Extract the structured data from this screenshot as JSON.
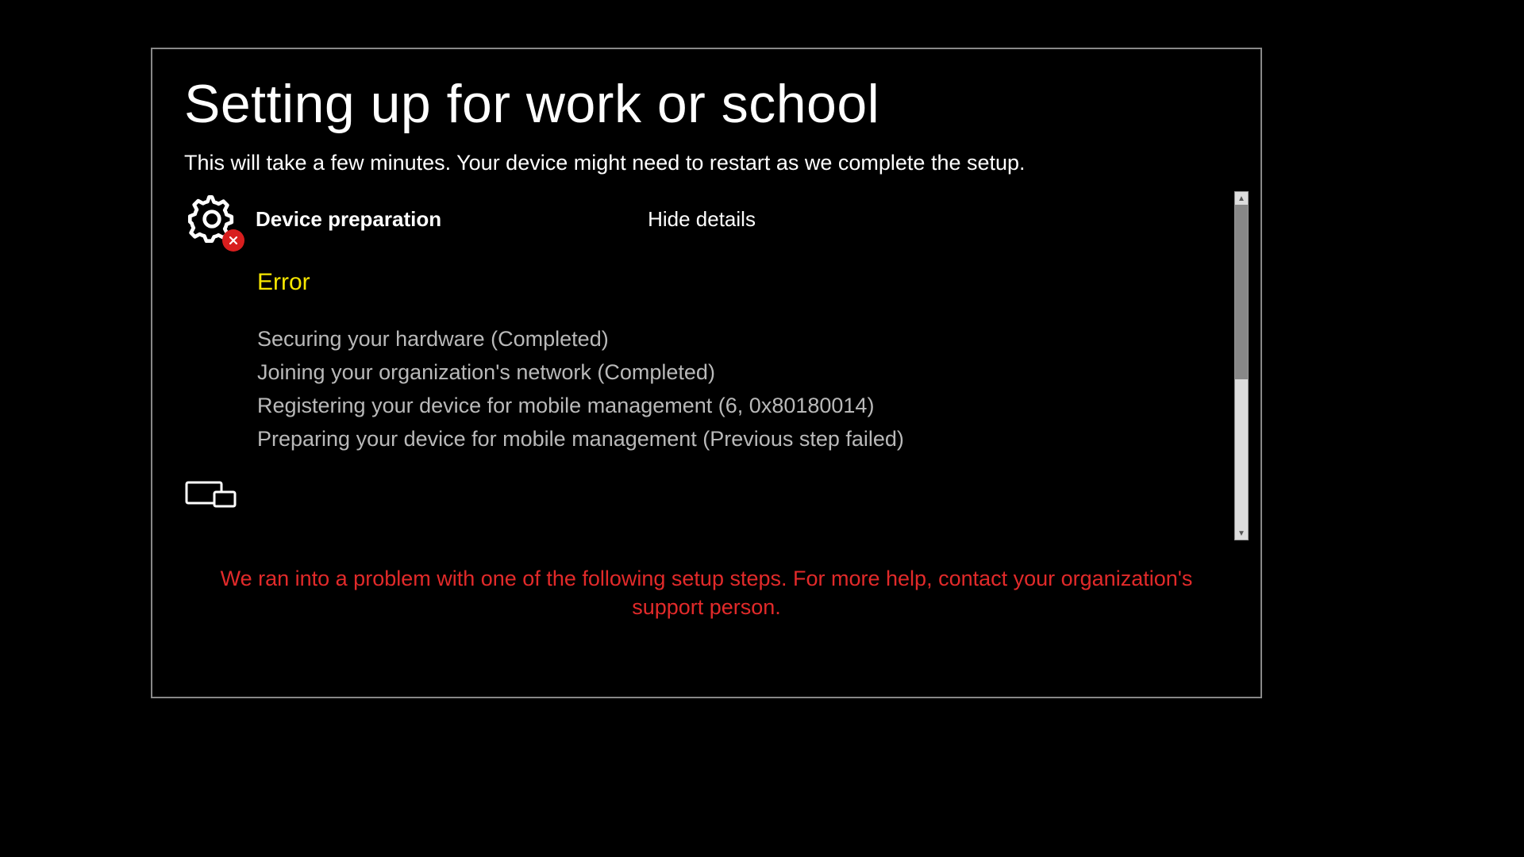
{
  "title": "Setting up for work or school",
  "subtitle": "This will take a few minutes. Your device might need to restart as we complete the setup.",
  "section": {
    "label": "Device preparation",
    "toggle": "Hide details",
    "status": "Error",
    "steps": [
      "Securing your hardware (Completed)",
      "Joining your organization's network (Completed)",
      "Registering your device for mobile management (6, 0x80180014)",
      "Preparing your device for mobile management (Previous step failed)"
    ]
  },
  "footer_error": "We ran into a problem with one of the following setup steps. For more help, contact your organization's support person."
}
